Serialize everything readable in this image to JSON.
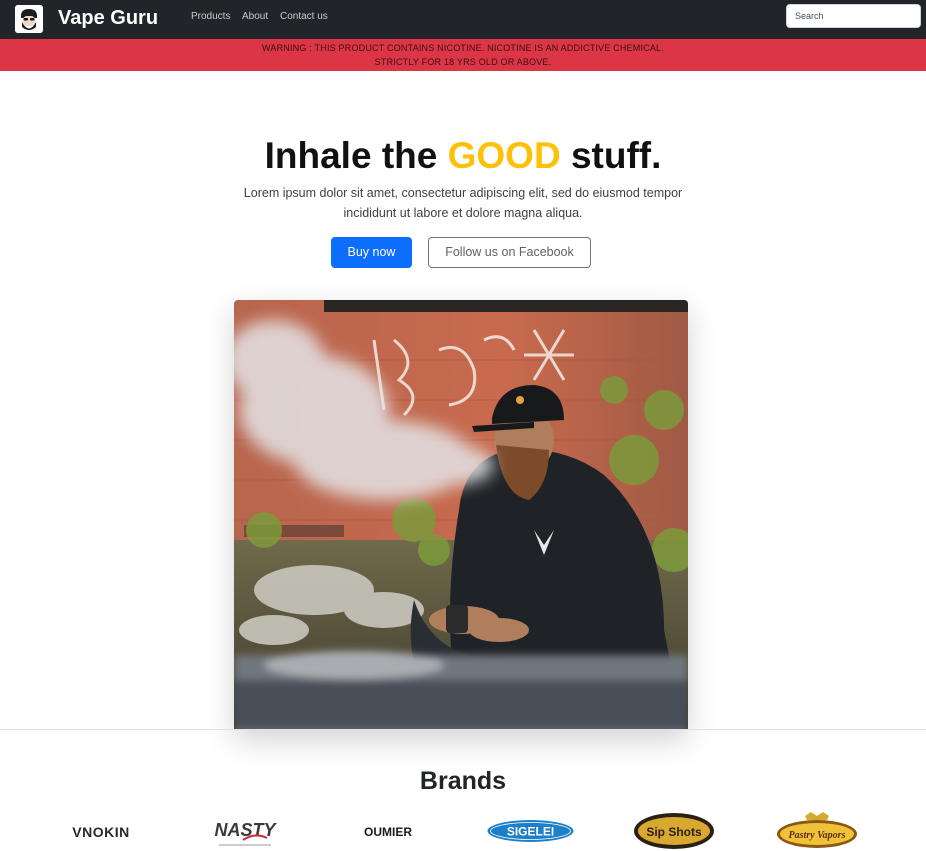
{
  "navbar": {
    "brand": "Vape Guru",
    "links": [
      "Products",
      "About",
      "Contact us"
    ],
    "search_placeholder": "Search"
  },
  "warning": {
    "line1": "WARNING : THIS PRODUCT CONTAINS NICOTINE. NICOTINE IS AN ADDICTIVE CHEMICAL.",
    "line2": "STRICTLY FOR 18 YRS OLD OR ABOVE."
  },
  "hero": {
    "title_before": "Inhale the ",
    "title_accent": "GOOD",
    "title_after": " stuff.",
    "lead": "Lorem ipsum dolor sit amet, consectetur adipiscing elit, sed do eiusmod tempor incididunt ut labore et dolore magna aliqua.",
    "buy_label": "Buy now",
    "follow_label": "Follow us on Facebook"
  },
  "brands": {
    "title": "Brands",
    "logos": [
      "VNOKIN",
      "NASTY",
      "OUMIER",
      "SIGELEI",
      "Sip Shots",
      "Pastry Vapors"
    ]
  },
  "colors": {
    "navbar_bg": "#212529",
    "warning_bg": "#dc3545",
    "accent_yellow": "#ffc107",
    "primary_blue": "#0d6efd"
  }
}
